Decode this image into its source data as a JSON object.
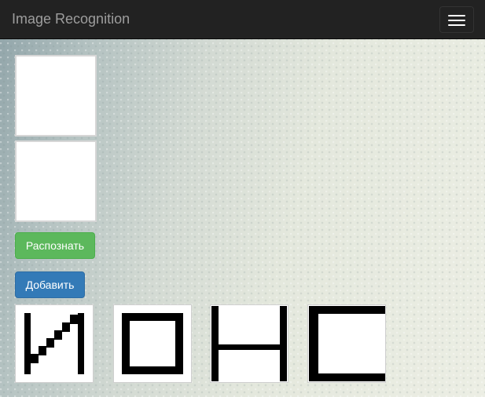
{
  "navbar": {
    "brand": "Image Recognition",
    "menu_icon": "hamburger-icon"
  },
  "canvases": [
    "drawing-canvas",
    "result-canvas"
  ],
  "buttons": {
    "recognize": "Распознать",
    "add": "Добавить"
  },
  "samples": [
    {
      "name": "sample-letter-I"
    },
    {
      "name": "sample-letter-O"
    },
    {
      "name": "sample-letter-N"
    },
    {
      "name": "sample-letter-C"
    }
  ],
  "colors": {
    "navbar_bg": "#222222",
    "brand_text": "#9d9d9d",
    "success": "#5cb85c",
    "primary": "#337ab7"
  }
}
